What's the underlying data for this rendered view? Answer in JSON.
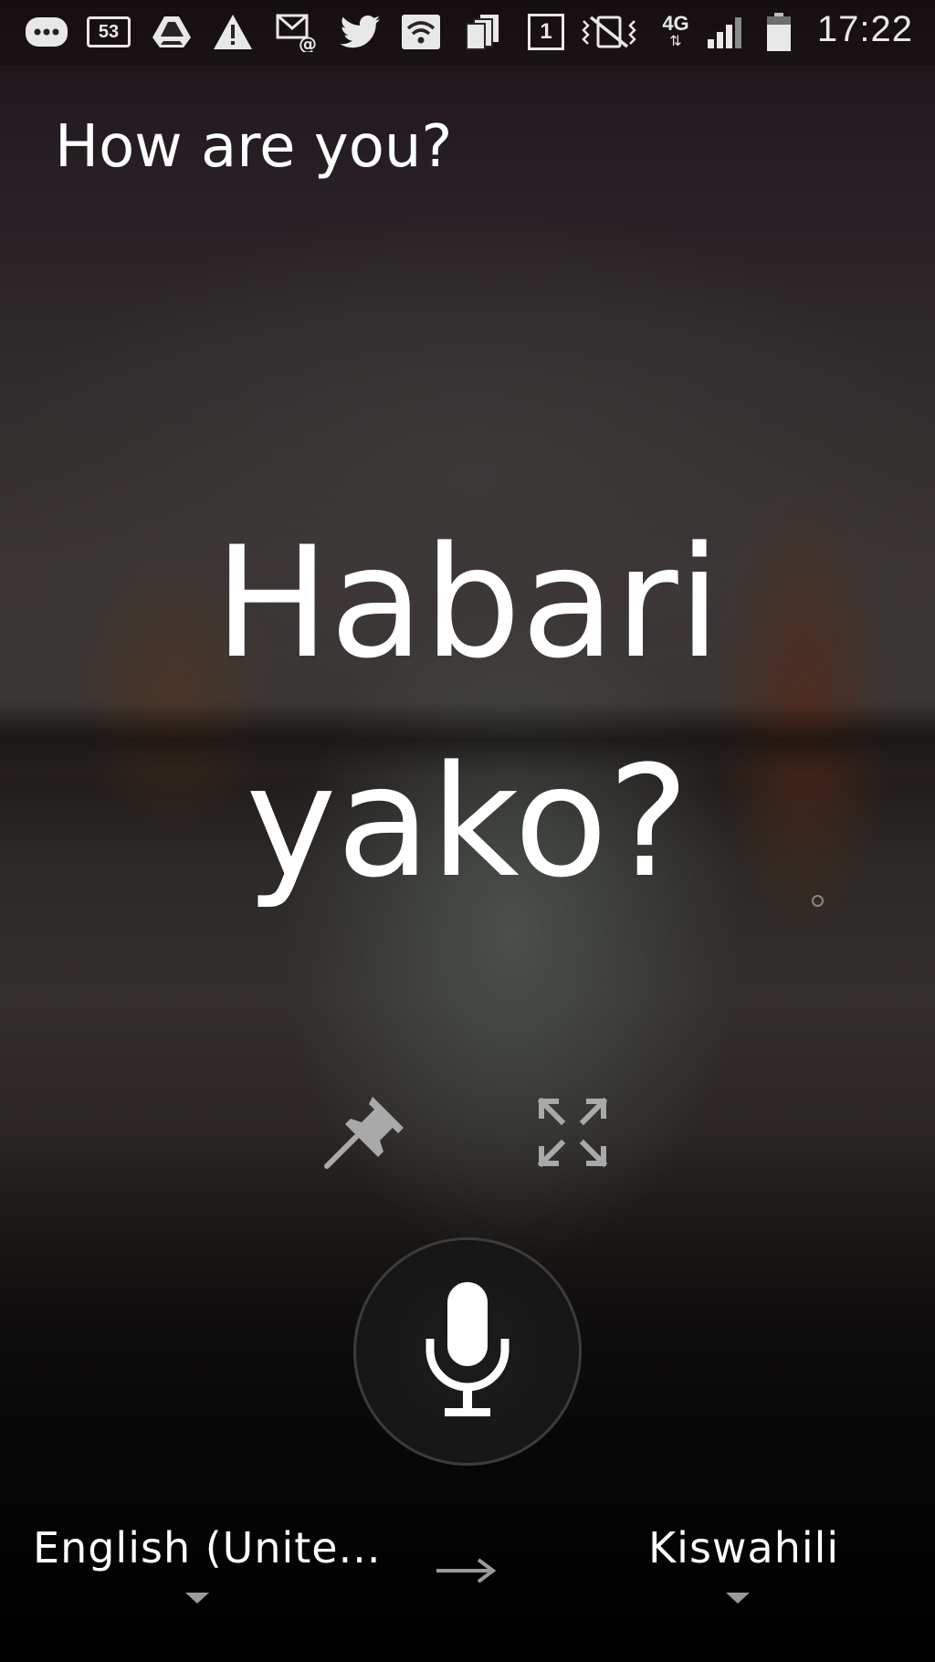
{
  "status_bar": {
    "time": "17:22",
    "notification_count": "53",
    "sim_slot": "1",
    "network_type": "4G",
    "icons": [
      "more-icon",
      "message-count-icon",
      "drive-icon",
      "warning-icon",
      "email-icon",
      "twitter-icon",
      "wifi-icon",
      "stack-icon",
      "sim-icon",
      "vibrate-mute-icon",
      "network-4g-icon",
      "signal-icon",
      "battery-icon"
    ]
  },
  "translation_view": {
    "source_text": "How are you?",
    "translated_line1": "Habari",
    "translated_line2": "yako?"
  },
  "actions": {
    "pin_icon": "pin-icon",
    "expand_icon": "fullscreen-icon",
    "mic_icon": "microphone-icon"
  },
  "languages": {
    "source": "English (Unite...",
    "target": "Kiswahili",
    "arrow_icon": "arrow-right-icon"
  }
}
